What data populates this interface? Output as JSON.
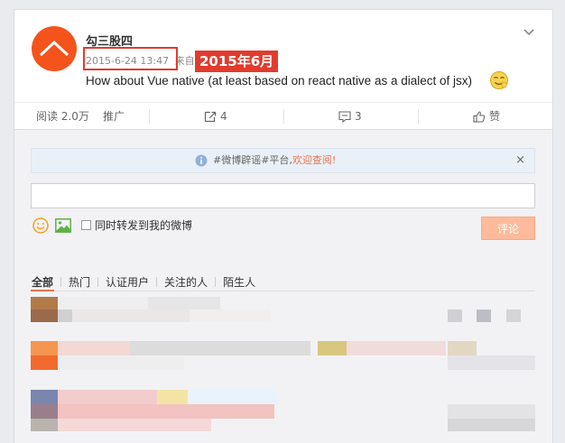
{
  "post": {
    "username": "勾三股四",
    "timestamp": "2015-6-24 13:47",
    "source_prefix": "来自",
    "annotation": "2015年6月",
    "text": "How about Vue native (at least based on react native as a dialect of jsx)"
  },
  "actions": {
    "read_count": "阅读 2.0万",
    "promote": "推广",
    "forward_count": "4",
    "comment_count": "3",
    "like_label": "赞"
  },
  "comments": {
    "notice_text": "#微博辟谣#平台,",
    "notice_link": "欢迎查阅!",
    "notice_close": "×",
    "input_value": "",
    "forward_label": "同时转发到我的微博",
    "submit_label": "评论",
    "filters": [
      "全部",
      "热门",
      "认证用户",
      "关注的人",
      "陌生人"
    ]
  },
  "colors": {
    "accent": "#eb7350",
    "avatar": "#f5531c",
    "annotation": "#e23b2e",
    "submit_disabled": "#fdbb9c"
  }
}
